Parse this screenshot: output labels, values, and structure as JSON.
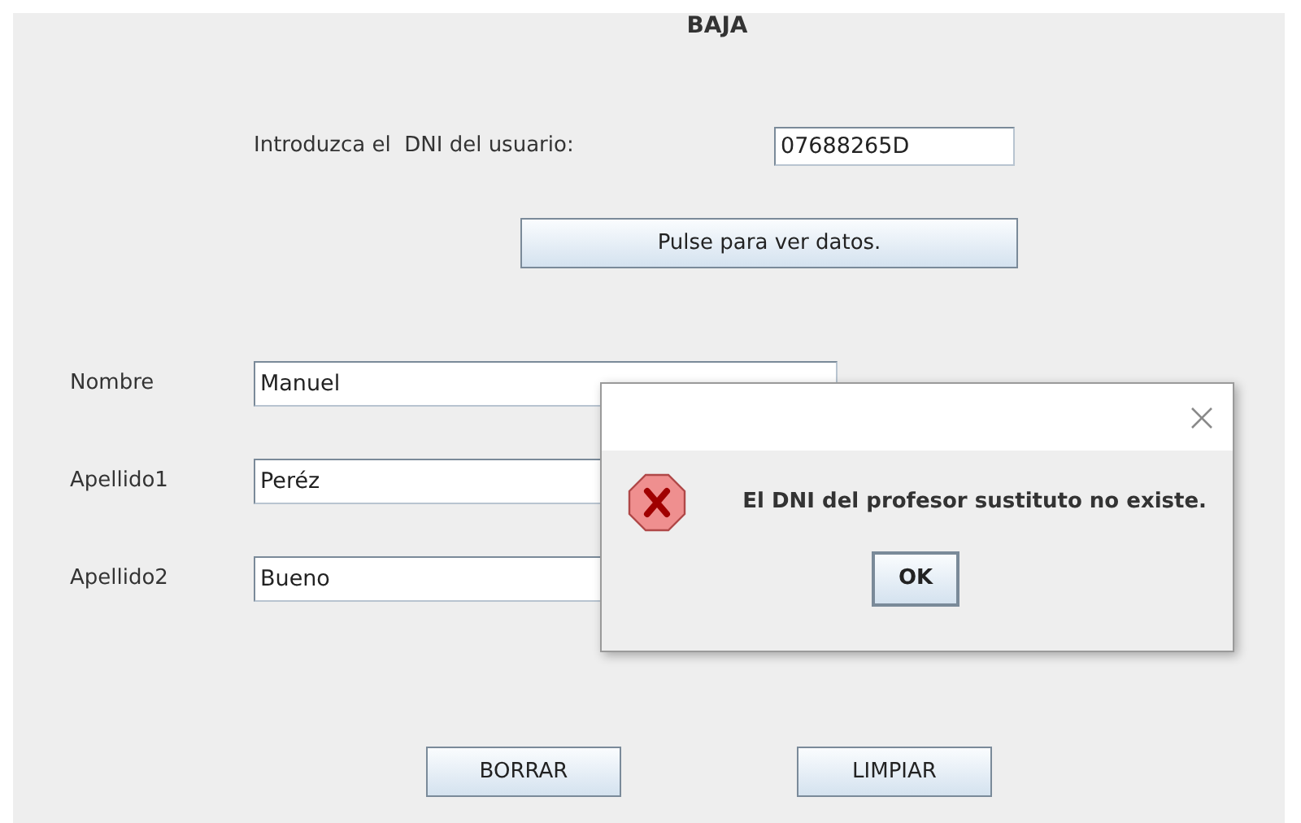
{
  "title": "BAJA",
  "dni": {
    "label": "Introduzca el  DNI del usuario:",
    "value": "07688265D"
  },
  "lookup_button": "Pulse para ver datos.",
  "fields": [
    {
      "label": "Nombre",
      "value": "Manuel"
    },
    {
      "label": "Apellido1",
      "value": "Peréz"
    },
    {
      "label": "Apellido2",
      "value": "Bueno"
    }
  ],
  "buttons": [
    "BORRAR",
    "LIMPIAR"
  ],
  "dialog": {
    "message": "El DNI del profesor sustituto no existe.",
    "ok_button": "OK"
  }
}
